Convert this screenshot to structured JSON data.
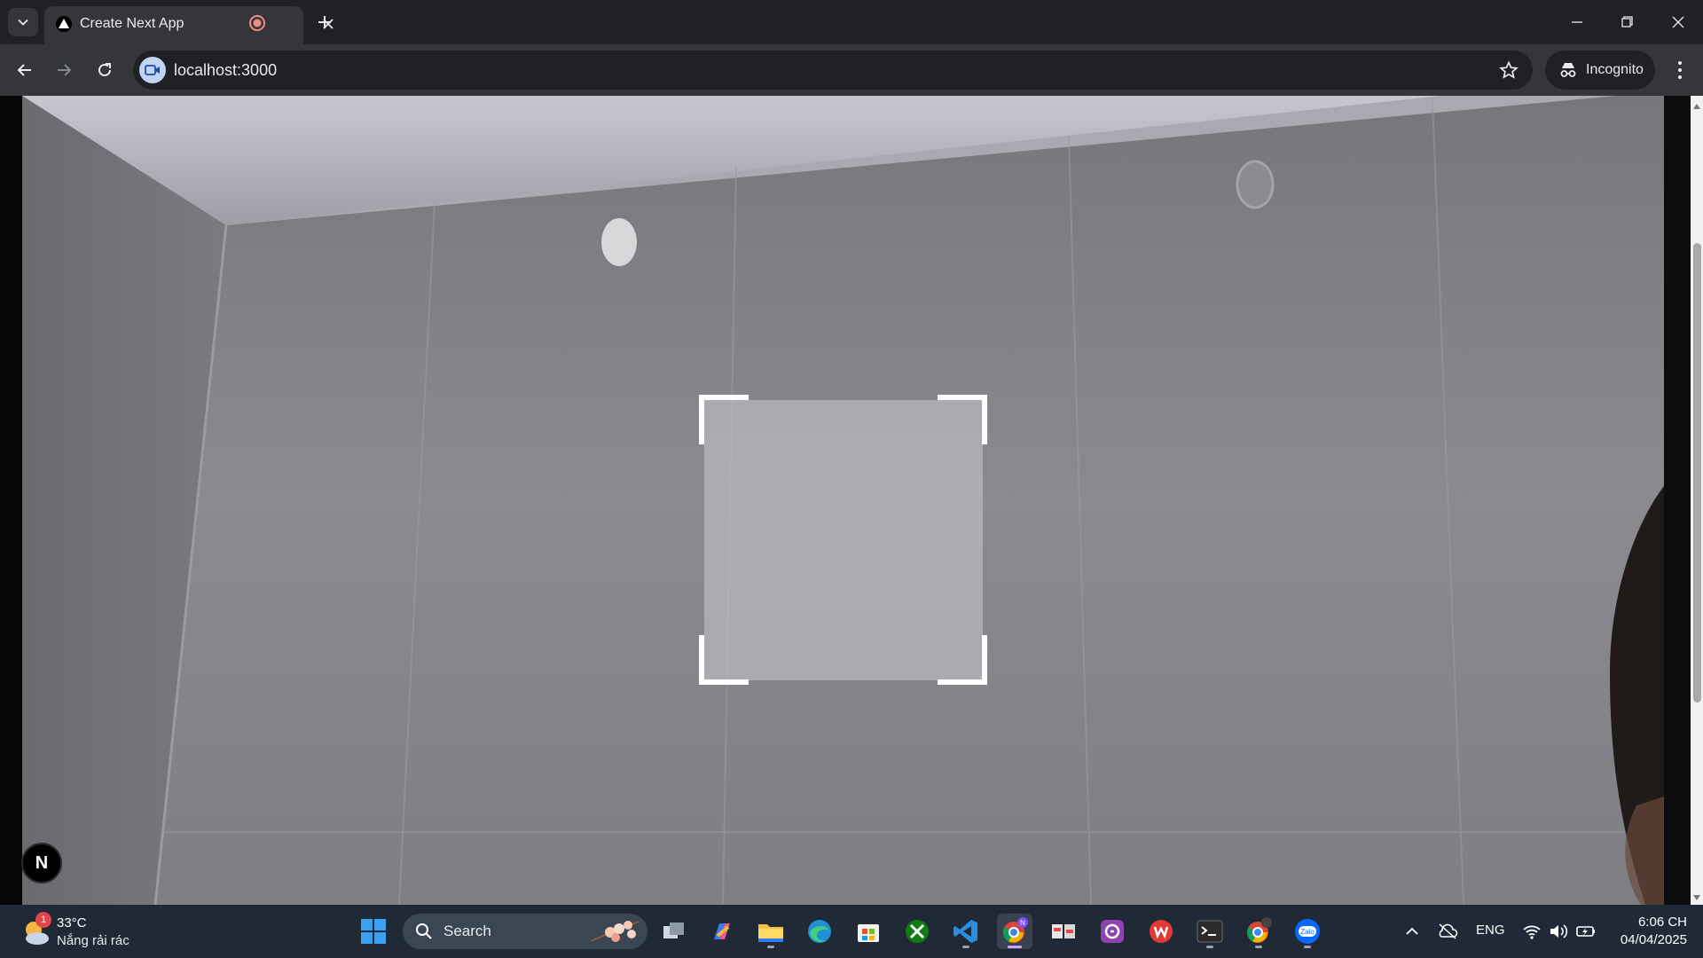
{
  "browser": {
    "tab": {
      "title": "Create Next App"
    },
    "url": "localhost:3000",
    "incognito_label": "Incognito"
  },
  "page": {
    "next_badge_letter": "N"
  },
  "taskbar": {
    "weather": {
      "temperature": "33°C",
      "description": "Nắng rải rác",
      "badge_count": "1"
    },
    "search_label": "Search",
    "language": "ENG",
    "time": "6:06 CH",
    "date": "04/04/2025",
    "pinned_apps": [
      "task-view",
      "copilot",
      "file-explorer",
      "edge",
      "microsoft-store",
      "xbox",
      "vscode",
      "chrome",
      "snipping",
      "messenger",
      "wps-office",
      "terminal",
      "chrome-profile",
      "zalo"
    ]
  },
  "colors": {
    "tab_bg": "#35363a",
    "chrome_bg": "#202124",
    "taskbar_bg": "#1f2a36",
    "scan_frame": "#ffffff"
  }
}
